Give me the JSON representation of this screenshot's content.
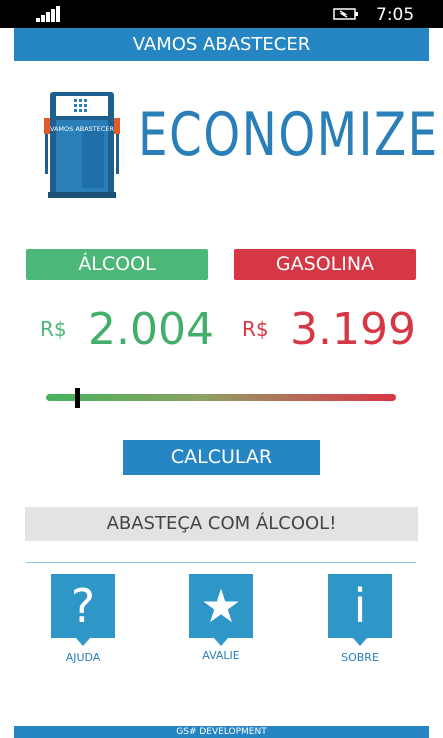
{
  "status_bar": {
    "time": "7:05",
    "signal_icon": "signal-bars-icon",
    "battery_icon": "battery-charging-icon"
  },
  "header": {
    "title": "VAMOS ABASTECER"
  },
  "logo": {
    "pump_label": "VAMOS ABASTECER",
    "brand": "ECONOMIZE"
  },
  "fuels": {
    "alcohol": {
      "label": "ÁLCOOL",
      "currency": "R$",
      "price": "2.004",
      "color": "#4cb877"
    },
    "gasoline": {
      "label": "GASOLINA",
      "currency": "R$",
      "price": "3.199",
      "color": "#d63744"
    }
  },
  "slider": {
    "level_fraction": 0.09
  },
  "calculate_button": "CALCULAR",
  "result": "ABASTEÇA COM ÁLCOOL!",
  "actions": [
    {
      "label": "AJUDA",
      "glyph": "?",
      "icon": "help-icon"
    },
    {
      "label": "AVALIE",
      "glyph": "★",
      "icon": "star-icon"
    },
    {
      "label": "SOBRE",
      "glyph": "i",
      "icon": "info-icon"
    }
  ],
  "footer": "GS# DEVELOPMENT",
  "colors": {
    "accent": "#2686c4",
    "alcohol": "#4cb877",
    "gasoline": "#d63744"
  }
}
